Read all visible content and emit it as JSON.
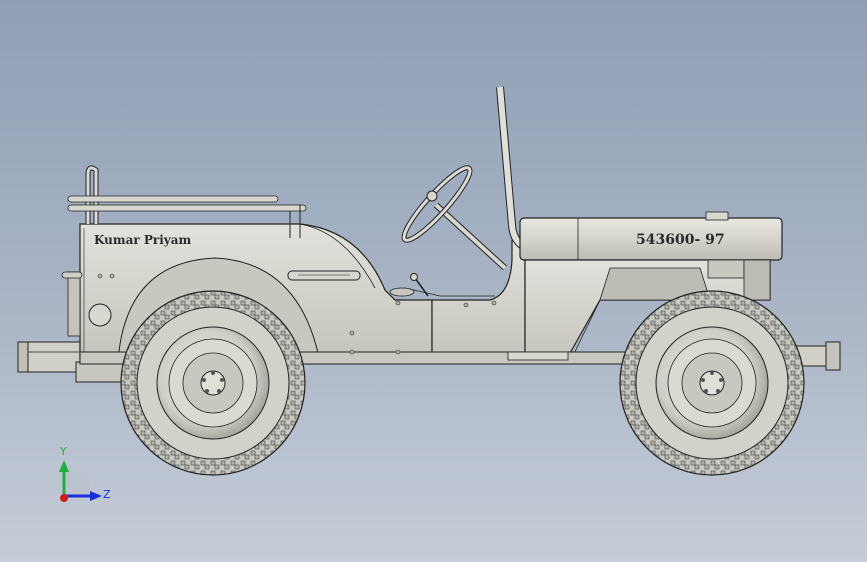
{
  "model": {
    "hood_marking": "543600- 97",
    "side_lettering": "Kumar Priyam"
  },
  "triad": {
    "y_label": "Y",
    "z_label": "Z",
    "colors": {
      "y": "#1db33a",
      "z": "#1a2fd8",
      "x": "#d41a1a"
    }
  },
  "colors": {
    "background_top": "#8f9fb6",
    "background_bottom": "#c6cdd8",
    "model_body": "#cfcfc8",
    "edge_lines": "#222222"
  }
}
